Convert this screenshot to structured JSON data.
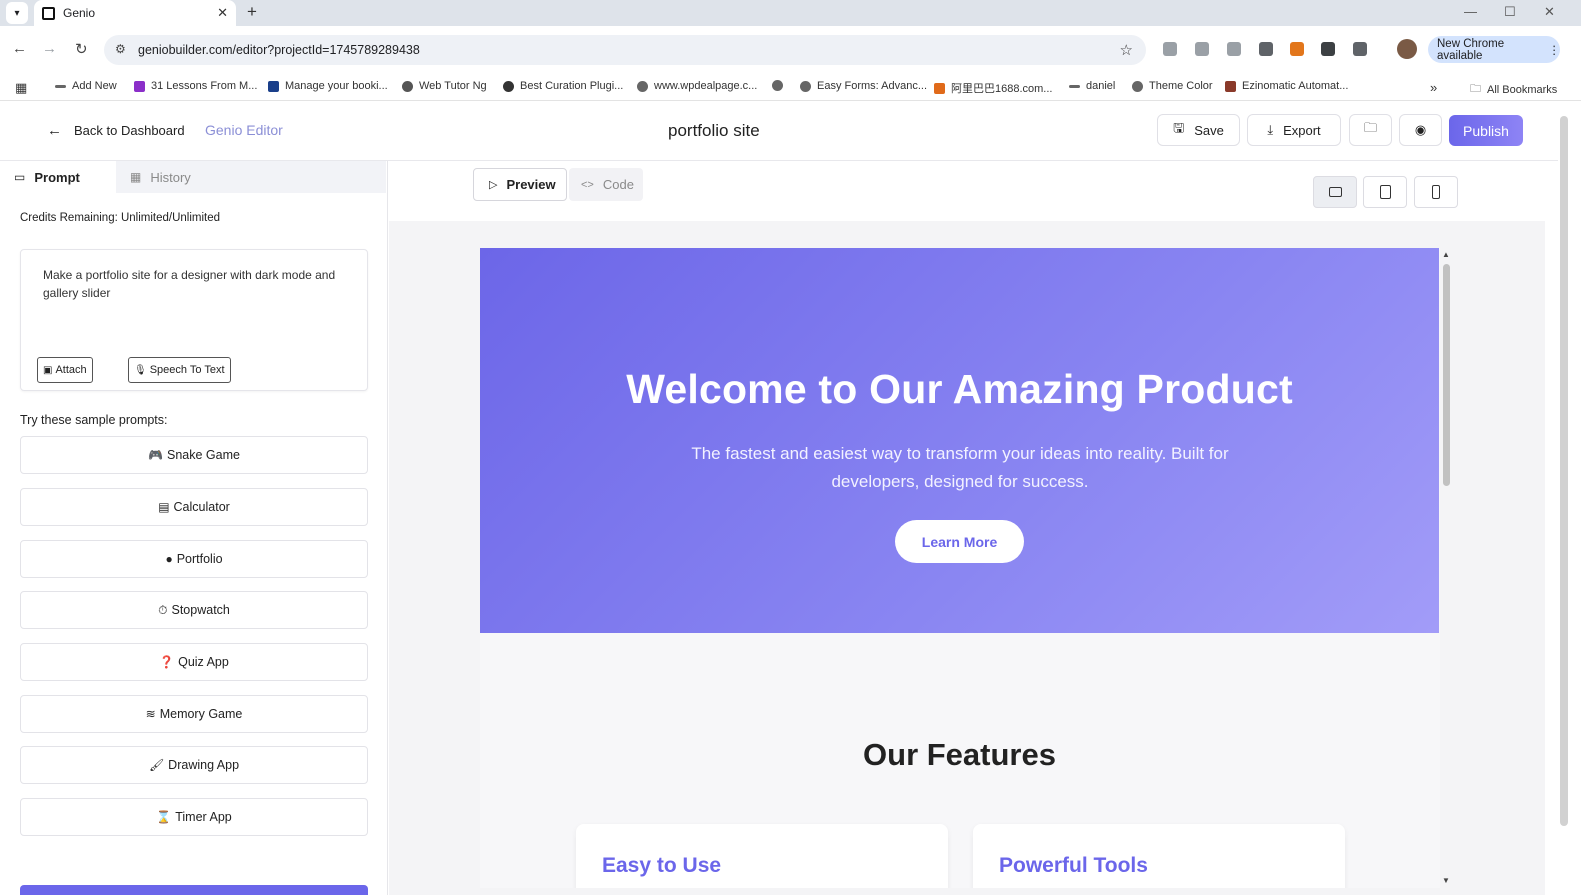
{
  "browser": {
    "tab_title": "Genio",
    "url": "geniobuilder.com/editor?projectId=1745789289438",
    "new_chrome_label": "New Chrome available",
    "bookmarks": [
      {
        "label": "Add New"
      },
      {
        "label": "31 Lessons From M..."
      },
      {
        "label": "Manage your booki..."
      },
      {
        "label": "Web Tutor Ng"
      },
      {
        "label": "Best Curation Plugi..."
      },
      {
        "label": "www.wpdealpage.c..."
      },
      {
        "label": ""
      },
      {
        "label": "Easy Forms: Advanc..."
      },
      {
        "label": "阿里巴巴1688.com..."
      },
      {
        "label": "daniel"
      },
      {
        "label": "Theme Color"
      },
      {
        "label": "Ezinomatic Automat..."
      }
    ],
    "more_bookmarks": "»",
    "all_bookmarks": "All Bookmarks"
  },
  "header": {
    "back_label": "Back to Dashboard",
    "brand": "Genio Editor",
    "project_name": "portfolio site",
    "save_label": "Save",
    "export_label": "Export",
    "publish_label": "Publish"
  },
  "sidebar": {
    "tabs": [
      {
        "label": "Prompt",
        "active": true
      },
      {
        "label": "History",
        "active": false
      }
    ],
    "credits": "Credits Remaining: Unlimited/Unlimited",
    "prompt_text": "Make a portfolio site for a designer with dark mode and gallery slider",
    "attach_label": "Attach",
    "speech_label": "Speech To Text",
    "samples_heading": "Try these sample prompts:",
    "samples": [
      {
        "label": "Snake Game",
        "icon": "gamepad-icon"
      },
      {
        "label": "Calculator",
        "icon": "calculator-icon"
      },
      {
        "label": "Portfolio",
        "icon": "user-circle-icon"
      },
      {
        "label": "Stopwatch",
        "icon": "stopwatch-icon"
      },
      {
        "label": "Quiz App",
        "icon": "question-circle-icon"
      },
      {
        "label": "Memory Game",
        "icon": "layers-icon"
      },
      {
        "label": "Drawing App",
        "icon": "paintbrush-icon"
      },
      {
        "label": "Timer App",
        "icon": "hourglass-icon"
      }
    ]
  },
  "preview": {
    "tabs": [
      {
        "label": "Preview",
        "active": true
      },
      {
        "label": "Code",
        "active": false
      }
    ],
    "hero_title": "Welcome to Our Amazing Product",
    "hero_text": "The fastest and easiest way to transform your ideas into reality. Built for developers, designed for success.",
    "cta_label": "Learn More",
    "features_title": "Our Features",
    "feature_cards": [
      {
        "title": "Easy to Use"
      },
      {
        "title": "Powerful Tools"
      }
    ]
  },
  "colors": {
    "accent": "#6b66ea",
    "hero_gradient_start": "#6c66e8",
    "hero_gradient_end": "#a29cf8",
    "new_chrome_bg": "#d3e3fd"
  }
}
